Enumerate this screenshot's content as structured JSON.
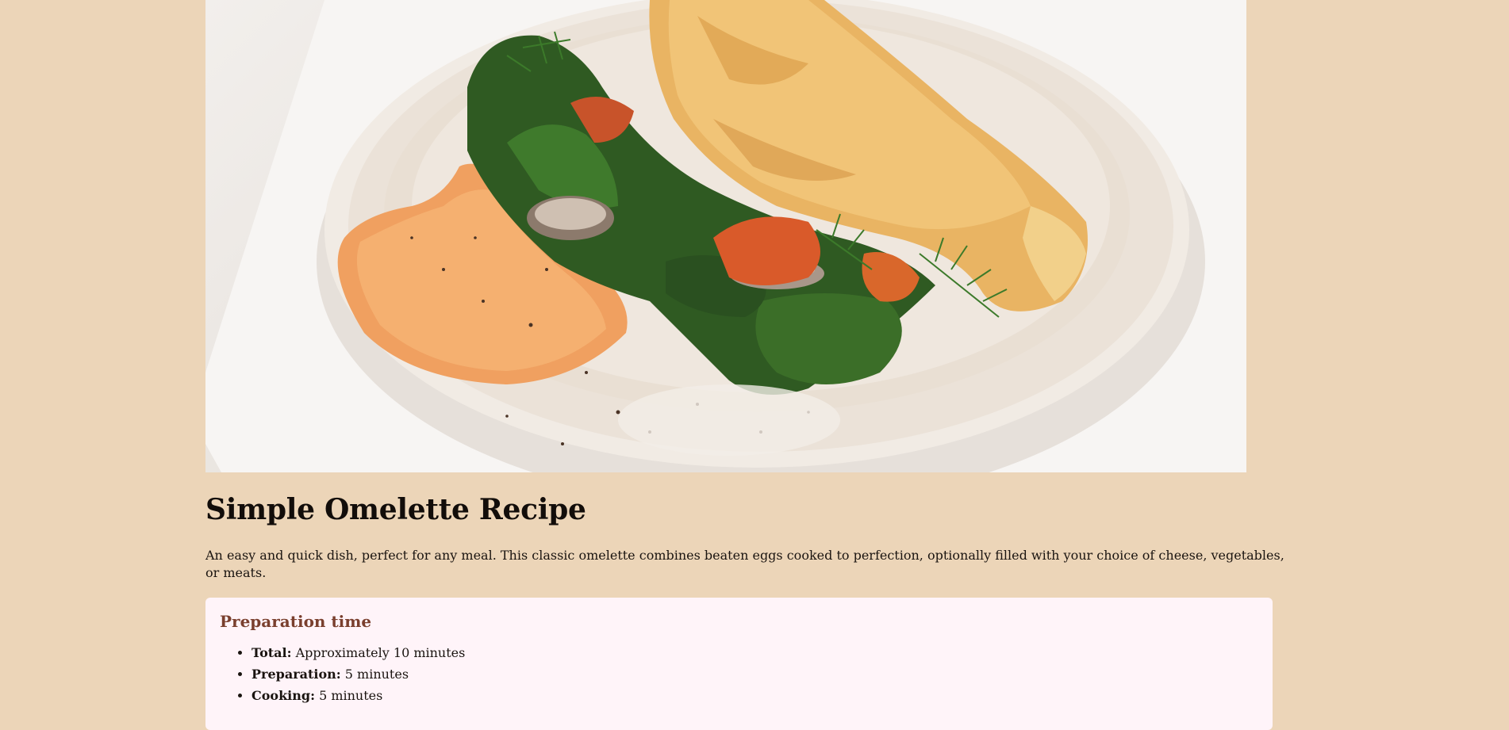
{
  "recipe": {
    "title": "Simple Omelette Recipe",
    "description": "An easy and quick dish, perfect for any meal. This classic omelette combines beaten eggs cooked to perfection, optionally filled with your choice of cheese, vegetables, or meats."
  },
  "preparation": {
    "heading": "Preparation time",
    "items": [
      {
        "label": "Total:",
        "value": "Approximately 10 minutes"
      },
      {
        "label": "Preparation:",
        "value": "5 minutes"
      },
      {
        "label": "Cooking:",
        "value": "5 minutes"
      }
    ]
  },
  "colors": {
    "page_background": "#ecd5b8",
    "card_background": "#fff4f9",
    "heading_accent": "#7a3f2e"
  }
}
